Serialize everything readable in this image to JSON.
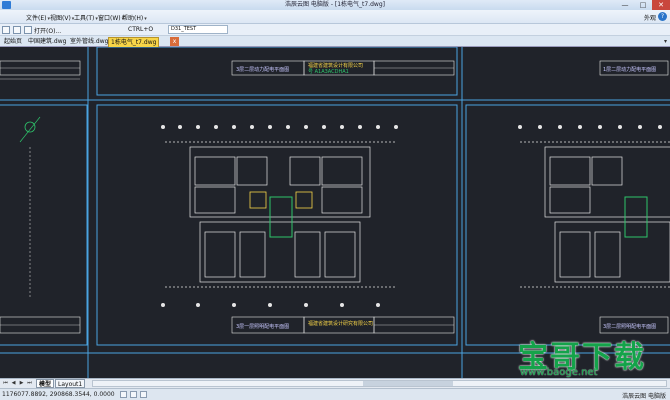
{
  "window": {
    "title": "浩辰云图 电脑版 - [1栋电气_t7.dwg]",
    "minimize": "—",
    "maximize": "□",
    "close": "✕"
  },
  "menu": {
    "items": [
      {
        "label": "文件(E)"
      },
      {
        "label": "视图(V)"
      },
      {
        "label": "工具(T)"
      },
      {
        "label": "窗口(W)"
      },
      {
        "label": "帮助(H)"
      }
    ],
    "appearance": "外观",
    "help_icon": "?"
  },
  "toolbar": {
    "open_label": "打开(O)...",
    "shortcut_label": "CTRL+O",
    "combo_value": "D31_TEST"
  },
  "tabs": {
    "items": [
      {
        "label": "起始页"
      },
      {
        "label": "中国建筑.dwg"
      },
      {
        "label": "室外管线.dwg"
      },
      {
        "label": "1栋电气_t7.dwg"
      }
    ],
    "close_icon": "x",
    "overflow_icon": "▾"
  },
  "drawing": {
    "titles": {
      "t1": "3层二层动力配电平面图",
      "t2": "1层二层动力配电平面图",
      "t3": "3层一层照明配电平面图",
      "t4": "3层二层照明配电平面图",
      "company": "福建省建筑设计有限公司",
      "company2": "福建省建筑设计研究有限公司",
      "design_no": "号 A1A3ACDHA1"
    }
  },
  "layout": {
    "tabs": [
      {
        "label": "模型"
      },
      {
        "label": "Layout1"
      }
    ]
  },
  "watermark": {
    "text": "宝哥下载",
    "url": "www.baoge.net"
  },
  "status": {
    "coords": "1176077.8892, 290868.3544, 0.0000",
    "app": "浩辰云图 电脑版"
  },
  "colors": {
    "canvas_bg": "#20232a",
    "frame_line": "#4aa3e0",
    "plan_line": "#e6e6e6",
    "text_line": "#c8c8ff",
    "accent_green": "#2ec46b"
  }
}
